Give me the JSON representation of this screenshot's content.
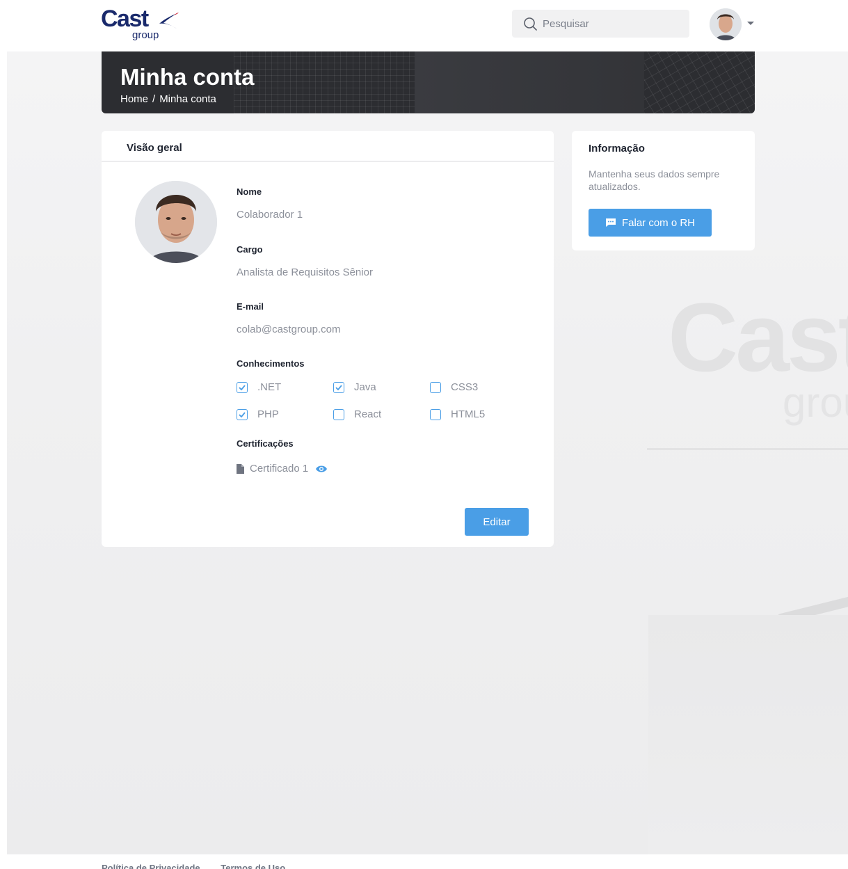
{
  "header": {
    "logo_main": "Cast",
    "logo_sub": "group",
    "search_placeholder": "Pesquisar"
  },
  "banner": {
    "title": "Minha conta",
    "breadcrumb": [
      "Home",
      "Minha conta"
    ]
  },
  "overview": {
    "title": "Visão geral",
    "fields": {
      "name_label": "Nome",
      "name_value": "Colaborador 1",
      "role_label": "Cargo",
      "role_value": "Analista de Requisitos Sênior",
      "email_label": "E-mail",
      "email_value": "colab@castgroup.com"
    },
    "skills_label": "Conhecimentos",
    "skills": [
      {
        "label": ".NET",
        "checked": true
      },
      {
        "label": "Java",
        "checked": true
      },
      {
        "label": "CSS3",
        "checked": false
      },
      {
        "label": "PHP",
        "checked": true
      },
      {
        "label": "React",
        "checked": false
      },
      {
        "label": "HTML5",
        "checked": false
      }
    ],
    "certs_label": "Certificações",
    "certs": [
      "Certificado 1"
    ],
    "edit_label": "Editar"
  },
  "info": {
    "title": "Informação",
    "description": "Mantenha seus dados sempre atualizados.",
    "hr_button": "Falar com o RH"
  },
  "footer": {
    "links": [
      "Política de Privacidade",
      "Termos de Uso"
    ]
  },
  "colors": {
    "accent": "#4a9ee6",
    "brand": "#1a2a6c"
  }
}
